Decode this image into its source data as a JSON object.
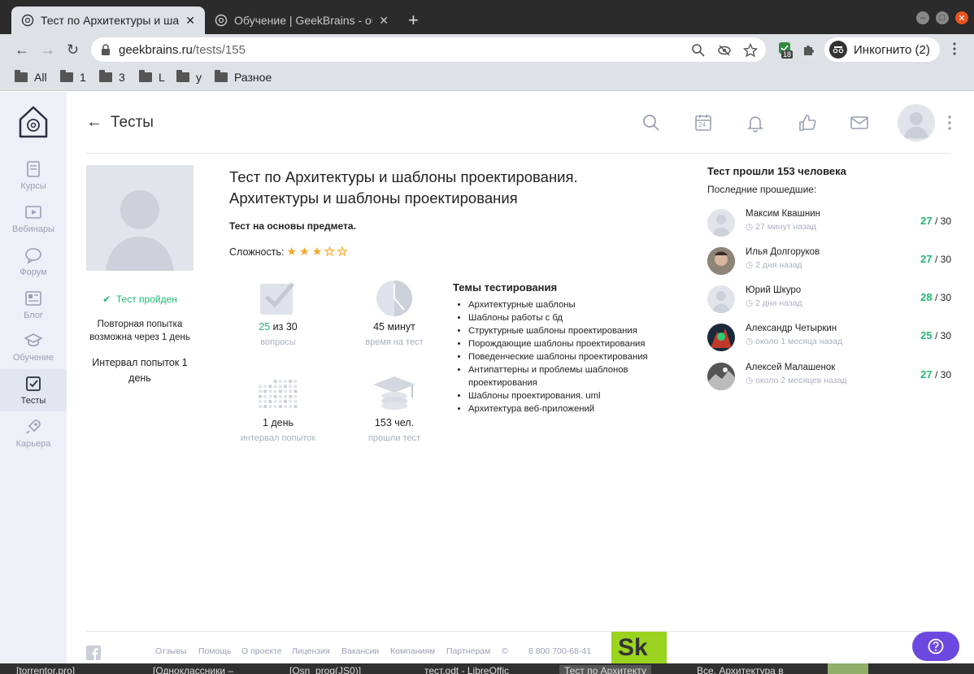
{
  "browser": {
    "tabs": [
      {
        "title": "Тест по Архитектуры и шабло",
        "active": true
      },
      {
        "title": "Обучение | GeekBrains - обра",
        "active": false
      }
    ],
    "url_domain": "geekbrains.ru",
    "url_path": "/tests/155",
    "incognito_label": "Инкогнито (2)",
    "extension_badge": "18",
    "bookmarks": [
      "All",
      "1",
      "3",
      "L",
      "y",
      "Разное"
    ]
  },
  "sidebar": {
    "items": [
      {
        "label": "Курсы",
        "icon": "book-icon"
      },
      {
        "label": "Вебинары",
        "icon": "video-icon"
      },
      {
        "label": "Форум",
        "icon": "chat-icon"
      },
      {
        "label": "Блог",
        "icon": "blog-icon"
      },
      {
        "label": "Обучение",
        "icon": "graduation-cap-icon"
      },
      {
        "label": "Тесты",
        "icon": "checkbox-icon",
        "active": true
      },
      {
        "label": "Карьера",
        "icon": "rocket-icon"
      }
    ]
  },
  "header": {
    "back_label": "Тесты",
    "calendar_day": "24"
  },
  "test": {
    "title": "Тест по Архитектуры и шаблоны проектирования. Архитектуры и шаблоны проектирования",
    "subtitle": "Тест на основы предмета.",
    "difficulty_label": "Сложность:",
    "difficulty_stars": 3,
    "difficulty_max": 5,
    "passed_label": "Тест пройден",
    "retry_text": "Повторная попытка возможна через 1 день",
    "interval_text": "Интервал попыток 1 день"
  },
  "stats": {
    "correct": "25",
    "correct_suffix": "из 30",
    "correct_label": "вопросы",
    "time_value": "45 минут",
    "time_label": "время на тест",
    "interval_value": "1 день",
    "interval_label": "интервал попыток",
    "people_value": "153 чел.",
    "people_label": "прошли тест"
  },
  "topics": {
    "heading": "Темы тестирования",
    "items": [
      "Архитектурные шаблоны",
      "Шаблоны работы с бд",
      "Структурные шаблоны проектирования",
      "Порождающие шаблоны проектирования",
      "Поведенческие шаблоны проектирования",
      "Антипаттерны и проблемы шаблонов проектирования",
      "Шаблоны проектирования. uml",
      "Архитектура веб-приложений"
    ]
  },
  "recent": {
    "count_text": "Тест прошли 153 человека",
    "last_label": "Последние прошедшие:",
    "people": [
      {
        "name": "Максим Квашнин",
        "time": "27 минут назад",
        "score": "27",
        "total": "/ 30"
      },
      {
        "name": "Илья Долгоруков",
        "time": "2 дня назад",
        "score": "27",
        "total": "/ 30"
      },
      {
        "name": "Юрий Шкуро",
        "time": "2 дня назад",
        "score": "28",
        "total": "/ 30"
      },
      {
        "name": "Александр Четыркин",
        "time": "около 1 месяца назад",
        "score": "25",
        "total": "/ 30"
      },
      {
        "name": "Алексей Малашенок",
        "time": "около 2 месяцев назад",
        "score": "27",
        "total": "/ 30"
      }
    ]
  },
  "footer": {
    "links": [
      "Отзывы",
      "Помощь",
      "О проекте",
      "Лицензия",
      "Вакансии",
      "Компаниям",
      "Партнерам",
      "©"
    ],
    "phone": "8 800 700-68-41",
    "logo_text": "Sk"
  },
  "taskbar": {
    "items": [
      "[torrentor.pro]",
      "[Одноклассники –",
      "[Osn_prog(JS0)]",
      "тест.odt - LibreOffic",
      "Тест по Архитекту",
      "Все. Архитектура в"
    ]
  },
  "colors": {
    "accent_green": "#22b573",
    "help_purple": "#6c48e0",
    "star_orange": "#f5a623",
    "sidebar_bg": "#eef0f8"
  }
}
